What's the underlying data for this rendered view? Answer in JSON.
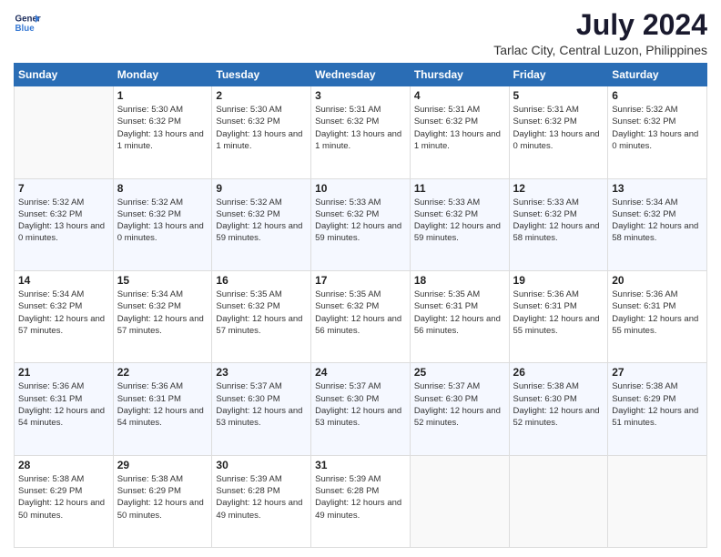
{
  "header": {
    "logo_line1": "General",
    "logo_line2": "Blue",
    "title": "July 2024",
    "subtitle": "Tarlac City, Central Luzon, Philippines"
  },
  "weekdays": [
    "Sunday",
    "Monday",
    "Tuesday",
    "Wednesday",
    "Thursday",
    "Friday",
    "Saturday"
  ],
  "weeks": [
    [
      {
        "day": "",
        "sunrise": "",
        "sunset": "",
        "daylight": ""
      },
      {
        "day": "1",
        "sunrise": "Sunrise: 5:30 AM",
        "sunset": "Sunset: 6:32 PM",
        "daylight": "Daylight: 13 hours and 1 minute."
      },
      {
        "day": "2",
        "sunrise": "Sunrise: 5:30 AM",
        "sunset": "Sunset: 6:32 PM",
        "daylight": "Daylight: 13 hours and 1 minute."
      },
      {
        "day": "3",
        "sunrise": "Sunrise: 5:31 AM",
        "sunset": "Sunset: 6:32 PM",
        "daylight": "Daylight: 13 hours and 1 minute."
      },
      {
        "day": "4",
        "sunrise": "Sunrise: 5:31 AM",
        "sunset": "Sunset: 6:32 PM",
        "daylight": "Daylight: 13 hours and 1 minute."
      },
      {
        "day": "5",
        "sunrise": "Sunrise: 5:31 AM",
        "sunset": "Sunset: 6:32 PM",
        "daylight": "Daylight: 13 hours and 0 minutes."
      },
      {
        "day": "6",
        "sunrise": "Sunrise: 5:32 AM",
        "sunset": "Sunset: 6:32 PM",
        "daylight": "Daylight: 13 hours and 0 minutes."
      }
    ],
    [
      {
        "day": "7",
        "sunrise": "Sunrise: 5:32 AM",
        "sunset": "Sunset: 6:32 PM",
        "daylight": "Daylight: 13 hours and 0 minutes."
      },
      {
        "day": "8",
        "sunrise": "Sunrise: 5:32 AM",
        "sunset": "Sunset: 6:32 PM",
        "daylight": "Daylight: 13 hours and 0 minutes."
      },
      {
        "day": "9",
        "sunrise": "Sunrise: 5:32 AM",
        "sunset": "Sunset: 6:32 PM",
        "daylight": "Daylight: 12 hours and 59 minutes."
      },
      {
        "day": "10",
        "sunrise": "Sunrise: 5:33 AM",
        "sunset": "Sunset: 6:32 PM",
        "daylight": "Daylight: 12 hours and 59 minutes."
      },
      {
        "day": "11",
        "sunrise": "Sunrise: 5:33 AM",
        "sunset": "Sunset: 6:32 PM",
        "daylight": "Daylight: 12 hours and 59 minutes."
      },
      {
        "day": "12",
        "sunrise": "Sunrise: 5:33 AM",
        "sunset": "Sunset: 6:32 PM",
        "daylight": "Daylight: 12 hours and 58 minutes."
      },
      {
        "day": "13",
        "sunrise": "Sunrise: 5:34 AM",
        "sunset": "Sunset: 6:32 PM",
        "daylight": "Daylight: 12 hours and 58 minutes."
      }
    ],
    [
      {
        "day": "14",
        "sunrise": "Sunrise: 5:34 AM",
        "sunset": "Sunset: 6:32 PM",
        "daylight": "Daylight: 12 hours and 57 minutes."
      },
      {
        "day": "15",
        "sunrise": "Sunrise: 5:34 AM",
        "sunset": "Sunset: 6:32 PM",
        "daylight": "Daylight: 12 hours and 57 minutes."
      },
      {
        "day": "16",
        "sunrise": "Sunrise: 5:35 AM",
        "sunset": "Sunset: 6:32 PM",
        "daylight": "Daylight: 12 hours and 57 minutes."
      },
      {
        "day": "17",
        "sunrise": "Sunrise: 5:35 AM",
        "sunset": "Sunset: 6:32 PM",
        "daylight": "Daylight: 12 hours and 56 minutes."
      },
      {
        "day": "18",
        "sunrise": "Sunrise: 5:35 AM",
        "sunset": "Sunset: 6:31 PM",
        "daylight": "Daylight: 12 hours and 56 minutes."
      },
      {
        "day": "19",
        "sunrise": "Sunrise: 5:36 AM",
        "sunset": "Sunset: 6:31 PM",
        "daylight": "Daylight: 12 hours and 55 minutes."
      },
      {
        "day": "20",
        "sunrise": "Sunrise: 5:36 AM",
        "sunset": "Sunset: 6:31 PM",
        "daylight": "Daylight: 12 hours and 55 minutes."
      }
    ],
    [
      {
        "day": "21",
        "sunrise": "Sunrise: 5:36 AM",
        "sunset": "Sunset: 6:31 PM",
        "daylight": "Daylight: 12 hours and 54 minutes."
      },
      {
        "day": "22",
        "sunrise": "Sunrise: 5:36 AM",
        "sunset": "Sunset: 6:31 PM",
        "daylight": "Daylight: 12 hours and 54 minutes."
      },
      {
        "day": "23",
        "sunrise": "Sunrise: 5:37 AM",
        "sunset": "Sunset: 6:30 PM",
        "daylight": "Daylight: 12 hours and 53 minutes."
      },
      {
        "day": "24",
        "sunrise": "Sunrise: 5:37 AM",
        "sunset": "Sunset: 6:30 PM",
        "daylight": "Daylight: 12 hours and 53 minutes."
      },
      {
        "day": "25",
        "sunrise": "Sunrise: 5:37 AM",
        "sunset": "Sunset: 6:30 PM",
        "daylight": "Daylight: 12 hours and 52 minutes."
      },
      {
        "day": "26",
        "sunrise": "Sunrise: 5:38 AM",
        "sunset": "Sunset: 6:30 PM",
        "daylight": "Daylight: 12 hours and 52 minutes."
      },
      {
        "day": "27",
        "sunrise": "Sunrise: 5:38 AM",
        "sunset": "Sunset: 6:29 PM",
        "daylight": "Daylight: 12 hours and 51 minutes."
      }
    ],
    [
      {
        "day": "28",
        "sunrise": "Sunrise: 5:38 AM",
        "sunset": "Sunset: 6:29 PM",
        "daylight": "Daylight: 12 hours and 50 minutes."
      },
      {
        "day": "29",
        "sunrise": "Sunrise: 5:38 AM",
        "sunset": "Sunset: 6:29 PM",
        "daylight": "Daylight: 12 hours and 50 minutes."
      },
      {
        "day": "30",
        "sunrise": "Sunrise: 5:39 AM",
        "sunset": "Sunset: 6:28 PM",
        "daylight": "Daylight: 12 hours and 49 minutes."
      },
      {
        "day": "31",
        "sunrise": "Sunrise: 5:39 AM",
        "sunset": "Sunset: 6:28 PM",
        "daylight": "Daylight: 12 hours and 49 minutes."
      },
      {
        "day": "",
        "sunrise": "",
        "sunset": "",
        "daylight": ""
      },
      {
        "day": "",
        "sunrise": "",
        "sunset": "",
        "daylight": ""
      },
      {
        "day": "",
        "sunrise": "",
        "sunset": "",
        "daylight": ""
      }
    ]
  ]
}
